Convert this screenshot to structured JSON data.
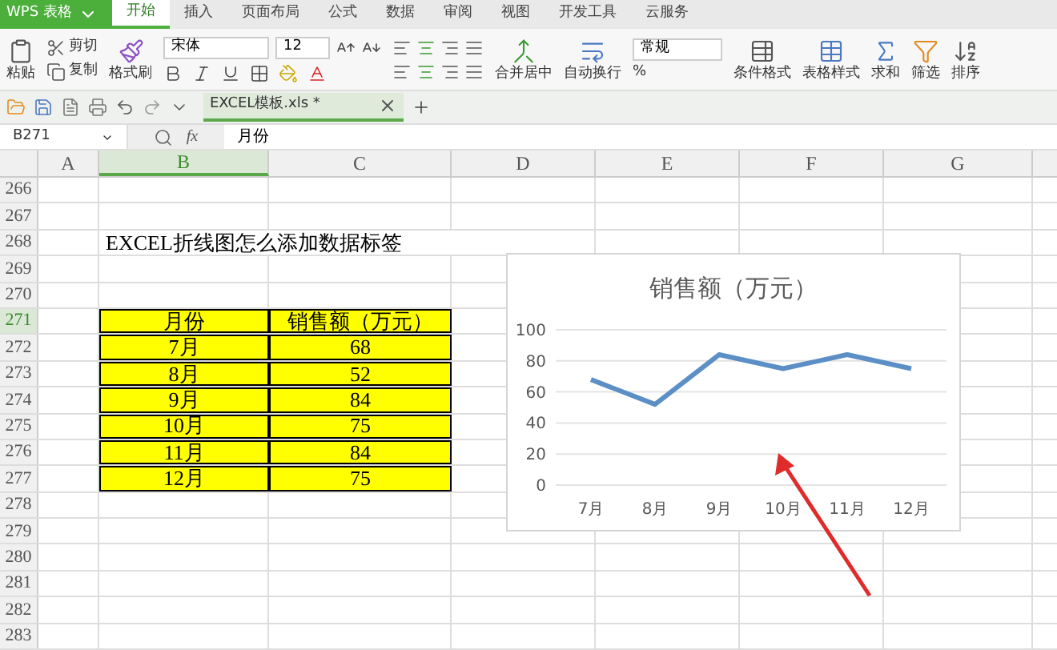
{
  "app": {
    "logo": "WPS 表格"
  },
  "menu_tabs": [
    {
      "label": "开始",
      "selected": true
    },
    {
      "label": "插入",
      "selected": false
    },
    {
      "label": "页面布局",
      "selected": false
    },
    {
      "label": "公式",
      "selected": false
    },
    {
      "label": "数据",
      "selected": false
    },
    {
      "label": "审阅",
      "selected": false
    },
    {
      "label": "视图",
      "selected": false
    },
    {
      "label": "开发工具",
      "selected": false
    },
    {
      "label": "云服务",
      "selected": false
    }
  ],
  "ribbon": {
    "paste": "粘贴",
    "cut": "剪切",
    "copy": "复制",
    "format_painter": "格式刷",
    "font_name": "宋体",
    "font_size": "12",
    "merge": "合并居中",
    "wrap": "自动换行",
    "number_format": "常规",
    "percent": "%",
    "conditional_format": "条件格式",
    "table_style": "表格样式",
    "sum": "求和",
    "filter": "筛选",
    "sort": "排序"
  },
  "document_tab": {
    "title": "EXCEL模板.xls *"
  },
  "formula_bar": {
    "cell_ref": "B271",
    "fx": "fx",
    "content": "月份"
  },
  "columns": [
    {
      "label": "A",
      "selected": false
    },
    {
      "label": "B",
      "selected": true
    },
    {
      "label": "C",
      "selected": false
    },
    {
      "label": "D",
      "selected": false
    },
    {
      "label": "E",
      "selected": false
    },
    {
      "label": "F",
      "selected": false
    },
    {
      "label": "G",
      "selected": false
    }
  ],
  "rows": [
    {
      "number": "266",
      "selected": false,
      "kind": "empty"
    },
    {
      "number": "267",
      "selected": false,
      "kind": "empty"
    },
    {
      "number": "268",
      "selected": false,
      "kind": "title",
      "b": "EXCEL折线图怎么添加数据标签"
    },
    {
      "number": "269",
      "selected": false,
      "kind": "empty"
    },
    {
      "number": "270",
      "selected": false,
      "kind": "empty"
    },
    {
      "number": "271",
      "selected": true,
      "kind": "table",
      "b": "月份",
      "c": "销售额（万元）"
    },
    {
      "number": "272",
      "selected": false,
      "kind": "table",
      "b": "7月",
      "c": "68"
    },
    {
      "number": "273",
      "selected": false,
      "kind": "table",
      "b": "8月",
      "c": "52"
    },
    {
      "number": "274",
      "selected": false,
      "kind": "table",
      "b": "9月",
      "c": "84"
    },
    {
      "number": "275",
      "selected": false,
      "kind": "table",
      "b": "10月",
      "c": "75"
    },
    {
      "number": "276",
      "selected": false,
      "kind": "table",
      "b": "11月",
      "c": "84"
    },
    {
      "number": "277",
      "selected": false,
      "kind": "table",
      "b": "12月",
      "c": "75"
    },
    {
      "number": "278",
      "selected": false,
      "kind": "empty"
    },
    {
      "number": "279",
      "selected": false,
      "kind": "empty"
    },
    {
      "number": "280",
      "selected": false,
      "kind": "empty"
    },
    {
      "number": "281",
      "selected": false,
      "kind": "empty"
    },
    {
      "number": "282",
      "selected": false,
      "kind": "empty"
    },
    {
      "number": "283",
      "selected": false,
      "kind": "empty"
    }
  ],
  "chart_data": {
    "type": "line",
    "title": "销售额（万元）",
    "categories": [
      "7月",
      "8月",
      "9月",
      "10月",
      "11月",
      "12月"
    ],
    "series": [
      {
        "color": "#5b8fc6",
        "values": [
          68,
          52,
          84,
          75,
          84,
          75
        ]
      }
    ],
    "grid": true,
    "ylim": [
      0,
      100
    ],
    "yticks": [
      0,
      20,
      40,
      60,
      80,
      100
    ]
  }
}
